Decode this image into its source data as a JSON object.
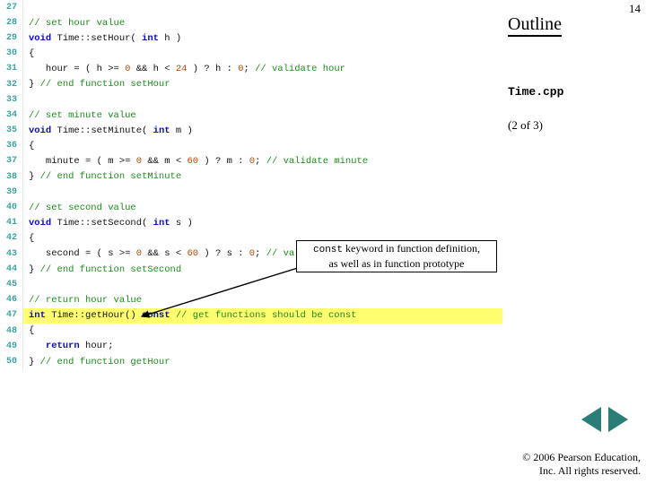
{
  "page_number": "14",
  "outline": "Outline",
  "file": "Time.cpp",
  "part": "(2 of 3)",
  "callout": {
    "code": "const",
    "line1_tail": " keyword in function definition,",
    "line2": "as well as in function prototype"
  },
  "copyright": {
    "l1": "© 2006 Pearson Education,",
    "l2": "Inc.  All rights reserved."
  },
  "code": [
    {
      "n": "27",
      "hl": false,
      "segs": []
    },
    {
      "n": "28",
      "hl": false,
      "segs": [
        {
          "c": "cmt",
          "t": "// set hour value"
        }
      ]
    },
    {
      "n": "29",
      "hl": false,
      "segs": [
        {
          "c": "kw",
          "t": "void"
        },
        {
          "c": "txt",
          "t": " Time::setHour( "
        },
        {
          "c": "kw",
          "t": "int"
        },
        {
          "c": "txt",
          "t": " h )"
        }
      ]
    },
    {
      "n": "30",
      "hl": false,
      "segs": [
        {
          "c": "txt",
          "t": "{"
        }
      ]
    },
    {
      "n": "31",
      "hl": false,
      "segs": [
        {
          "c": "txt",
          "t": "   hour = ( h >= "
        },
        {
          "c": "num",
          "t": "0"
        },
        {
          "c": "txt",
          "t": " && h < "
        },
        {
          "c": "num",
          "t": "24"
        },
        {
          "c": "txt",
          "t": " ) ? h : "
        },
        {
          "c": "num",
          "t": "0"
        },
        {
          "c": "txt",
          "t": "; "
        },
        {
          "c": "cmt",
          "t": "// validate hour"
        }
      ]
    },
    {
      "n": "32",
      "hl": false,
      "segs": [
        {
          "c": "txt",
          "t": "} "
        },
        {
          "c": "cmt",
          "t": "// end function setHour"
        }
      ]
    },
    {
      "n": "33",
      "hl": false,
      "segs": []
    },
    {
      "n": "34",
      "hl": false,
      "segs": [
        {
          "c": "cmt",
          "t": "// set minute value"
        }
      ]
    },
    {
      "n": "35",
      "hl": false,
      "segs": [
        {
          "c": "kw",
          "t": "void"
        },
        {
          "c": "txt",
          "t": " Time::setMinute( "
        },
        {
          "c": "kw",
          "t": "int"
        },
        {
          "c": "txt",
          "t": " m )"
        }
      ]
    },
    {
      "n": "36",
      "hl": false,
      "segs": [
        {
          "c": "txt",
          "t": "{"
        }
      ]
    },
    {
      "n": "37",
      "hl": false,
      "segs": [
        {
          "c": "txt",
          "t": "   minute = ( m >= "
        },
        {
          "c": "num",
          "t": "0"
        },
        {
          "c": "txt",
          "t": " && m < "
        },
        {
          "c": "num",
          "t": "60"
        },
        {
          "c": "txt",
          "t": " ) ? m : "
        },
        {
          "c": "num",
          "t": "0"
        },
        {
          "c": "txt",
          "t": "; "
        },
        {
          "c": "cmt",
          "t": "// validate minute"
        }
      ]
    },
    {
      "n": "38",
      "hl": false,
      "segs": [
        {
          "c": "txt",
          "t": "} "
        },
        {
          "c": "cmt",
          "t": "// end function setMinute"
        }
      ]
    },
    {
      "n": "39",
      "hl": false,
      "segs": []
    },
    {
      "n": "40",
      "hl": false,
      "segs": [
        {
          "c": "cmt",
          "t": "// set second value"
        }
      ]
    },
    {
      "n": "41",
      "hl": false,
      "segs": [
        {
          "c": "kw",
          "t": "void"
        },
        {
          "c": "txt",
          "t": " Time::setSecond( "
        },
        {
          "c": "kw",
          "t": "int"
        },
        {
          "c": "txt",
          "t": " s )"
        }
      ]
    },
    {
      "n": "42",
      "hl": false,
      "segs": [
        {
          "c": "txt",
          "t": "{"
        }
      ]
    },
    {
      "n": "43",
      "hl": false,
      "segs": [
        {
          "c": "txt",
          "t": "   second = ( s >= "
        },
        {
          "c": "num",
          "t": "0"
        },
        {
          "c": "txt",
          "t": " && s < "
        },
        {
          "c": "num",
          "t": "60"
        },
        {
          "c": "txt",
          "t": " ) ? s : "
        },
        {
          "c": "num",
          "t": "0"
        },
        {
          "c": "txt",
          "t": "; "
        },
        {
          "c": "cmt",
          "t": "// validate second"
        }
      ]
    },
    {
      "n": "44",
      "hl": false,
      "segs": [
        {
          "c": "txt",
          "t": "} "
        },
        {
          "c": "cmt",
          "t": "// end function setSecond"
        }
      ]
    },
    {
      "n": "45",
      "hl": false,
      "segs": []
    },
    {
      "n": "46",
      "hl": false,
      "segs": [
        {
          "c": "cmt",
          "t": "// return hour value"
        }
      ]
    },
    {
      "n": "47",
      "hl": true,
      "segs": [
        {
          "c": "kw",
          "t": "int"
        },
        {
          "c": "txt",
          "t": " Time::getHour() "
        },
        {
          "c": "kw",
          "t": "const"
        },
        {
          "c": "txt",
          "t": " "
        },
        {
          "c": "cmt",
          "t": "// get functions should be const"
        }
      ]
    },
    {
      "n": "48",
      "hl": false,
      "segs": [
        {
          "c": "txt",
          "t": "{"
        }
      ]
    },
    {
      "n": "49",
      "hl": false,
      "segs": [
        {
          "c": "txt",
          "t": "   "
        },
        {
          "c": "kw",
          "t": "return"
        },
        {
          "c": "txt",
          "t": " hour;"
        }
      ]
    },
    {
      "n": "50",
      "hl": false,
      "segs": [
        {
          "c": "txt",
          "t": "} "
        },
        {
          "c": "cmt",
          "t": "// end function getHour"
        }
      ]
    }
  ]
}
